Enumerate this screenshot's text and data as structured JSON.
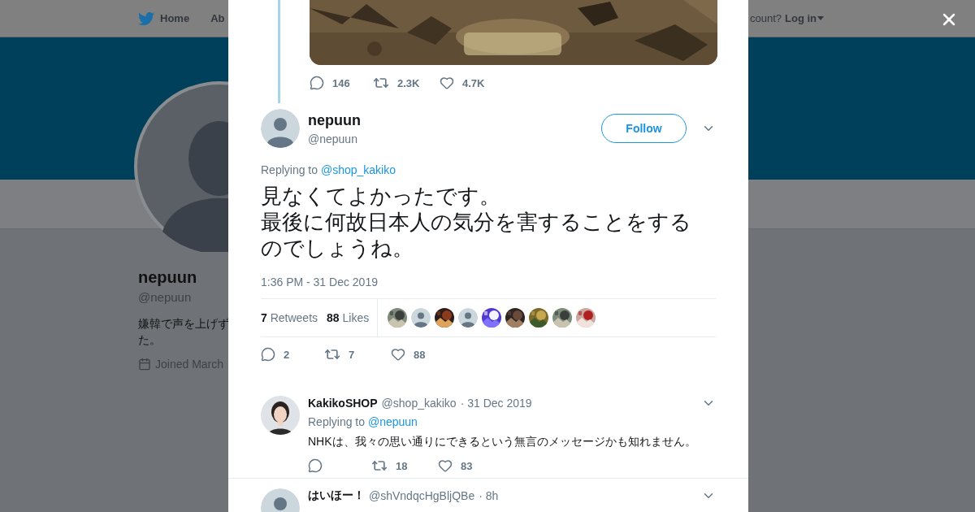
{
  "nav": {
    "home": "Home",
    "about": "Ab",
    "account_prompt": "count?",
    "login": "Log in"
  },
  "profile": {
    "name": "nepuun",
    "handle": "@nepuun",
    "bio_lines": [
      "嫌韓で声を上げず",
      "た。"
    ],
    "joined": "Joined March"
  },
  "thread_parent": {
    "media": {
      "kind": "picture"
    },
    "actions": {
      "replies": "146",
      "retweets": "2.3K",
      "likes": "4.7K"
    }
  },
  "tweet": {
    "avatar": {
      "kind": "default"
    },
    "name": "nepuun",
    "handle": "@nepuun",
    "follow": "Follow",
    "replying_label": "Replying to",
    "replying_to": "@shop_kakiko",
    "text_lines": [
      "見なくてよかったです。",
      "最後に何故日本人の気分を害することをする",
      "のでしょうね。"
    ],
    "time": "1:36 PM - 31 Dec 2019",
    "retweets_count": "7",
    "retweets_label": "Retweets",
    "likes_count": "88",
    "likes_label": "Likes",
    "likers": [
      {
        "kind": "picture"
      },
      {
        "kind": "default"
      },
      {
        "kind": "picture"
      },
      {
        "kind": "default"
      },
      {
        "kind": "picture"
      },
      {
        "kind": "picture"
      },
      {
        "kind": "picture"
      },
      {
        "kind": "picture"
      },
      {
        "kind": "picture"
      }
    ],
    "actions": {
      "replies": "2",
      "retweets": "7",
      "likes": "88"
    }
  },
  "replies": [
    {
      "avatar": {
        "kind": "picture"
      },
      "name": "KakikoSHOP",
      "handle": "@shop_kakiko",
      "time": "· 31 Dec 2019",
      "replying_label": "Replying to",
      "replying_to": "@nepuun",
      "text": "NHKは、我々の思い通りにできるという無言のメッセージかも知れません。",
      "actions": {
        "retweets": "18",
        "likes": "83"
      }
    },
    {
      "avatar": {
        "kind": "default"
      },
      "name": "はいほー！",
      "handle": "@shVndqcHgBljQBe",
      "time": "· 8h"
    }
  ]
}
